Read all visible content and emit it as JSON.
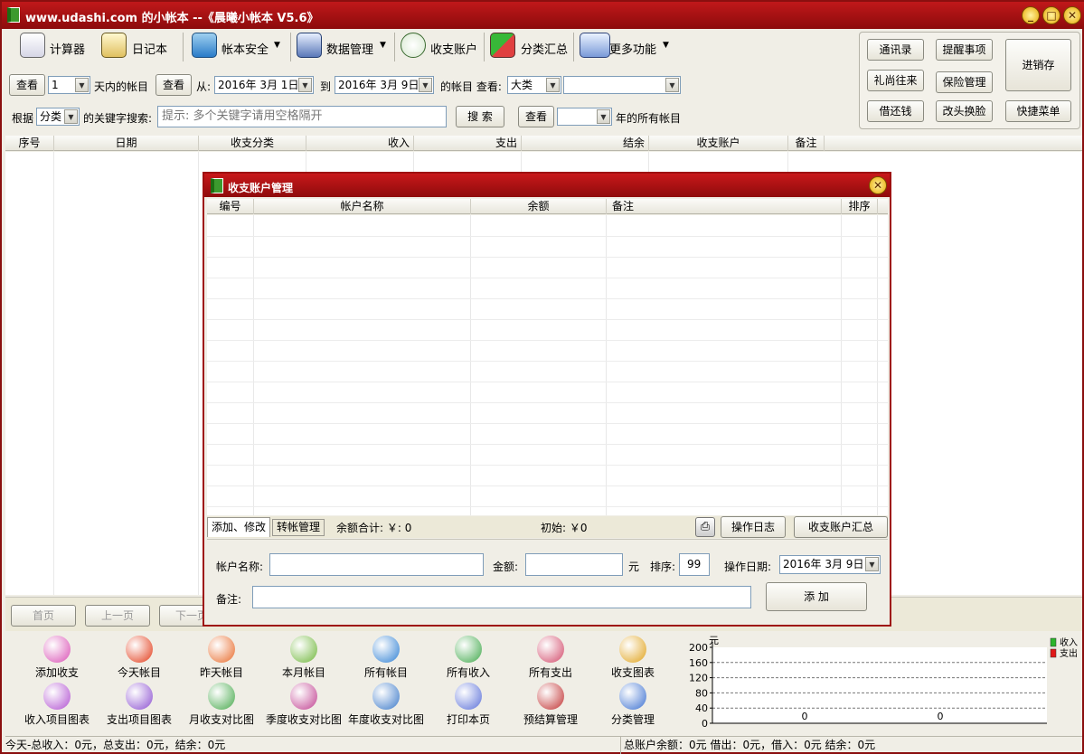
{
  "app": {
    "title": "www.udashi.com 的小帐本 --《晨曦小帐本 V5.6》"
  },
  "toolbar": {
    "items": [
      {
        "label": "计算器",
        "icon": "calculator-icon"
      },
      {
        "label": "日记本",
        "icon": "notebook-icon"
      },
      {
        "label": "帐本安全",
        "icon": "security-icon"
      },
      {
        "label": "数据管理",
        "icon": "data-icon"
      },
      {
        "label": "收支账户",
        "icon": "account-icon"
      },
      {
        "label": "分类汇总",
        "icon": "summary-icon"
      },
      {
        "label": "更多功能",
        "icon": "more-icon"
      }
    ],
    "dropdown_glyph": "▼"
  },
  "quick_panel": {
    "buttons": [
      "通讯录",
      "提醒事项",
      "礼尚往来",
      "保险管理",
      "借还钱",
      "改头换脸",
      "快捷菜单"
    ],
    "big_button": "进销存"
  },
  "filter1": {
    "view_label": "查看",
    "days_value": "1",
    "days_suffix": "天内的帐目",
    "view_label2": "查看",
    "from_label": "从:",
    "from_date": "2016年 3月 1日",
    "to_label": "到",
    "to_date": "2016年 3月 9日",
    "suffix": "的帐目 查看:",
    "type_value": "大类",
    "sub_value": ""
  },
  "filter2": {
    "by_label": "根据",
    "field_value": "分类",
    "keyword_label": "的关键字搜索:",
    "search_placeholder": "提示: 多个关键字请用空格隔开",
    "search_button": "搜 索",
    "view_label": "查看",
    "year_value": "",
    "year_suffix": "年的所有帐目"
  },
  "ledger": {
    "columns": [
      "序号",
      "日期",
      "收支分类",
      "收入",
      "支出",
      "结余",
      "收支账户",
      "备注"
    ]
  },
  "pager": {
    "first": "首页",
    "prev": "上一页",
    "next": "下一页"
  },
  "bottom_buttons": [
    {
      "label": "添加收支",
      "icon": "add-record-icon",
      "color": "#d94fb4"
    },
    {
      "label": "今天帐目",
      "icon": "today-icon",
      "color": "#e23a18"
    },
    {
      "label": "昨天帐目",
      "icon": "yesterday-icon",
      "color": "#e86a2a"
    },
    {
      "label": "本月帐目",
      "icon": "month-icon",
      "color": "#6fb63a"
    },
    {
      "label": "所有帐目",
      "icon": "all-records-icon",
      "color": "#2e7fd3"
    },
    {
      "label": "所有收入",
      "icon": "all-income-icon",
      "color": "#3fa84a"
    },
    {
      "label": "所有支出",
      "icon": "all-expense-icon",
      "color": "#d24a6a"
    },
    {
      "label": "收支图表",
      "icon": "chart-icon",
      "color": "#e0a21a"
    },
    {
      "label": "收入项目图表",
      "icon": "income-chart-icon",
      "color": "#b04fd0"
    },
    {
      "label": "支出项目图表",
      "icon": "expense-chart-icon",
      "color": "#8b4fd0"
    },
    {
      "label": "月收支对比图",
      "icon": "month-compare-icon",
      "color": "#45a84a"
    },
    {
      "label": "季度收支对比图",
      "icon": "quarter-compare-icon",
      "color": "#c04090"
    },
    {
      "label": "年度收支对比图",
      "icon": "year-compare-icon",
      "color": "#3a78c8"
    },
    {
      "label": "打印本页",
      "icon": "print-icon",
      "color": "#5a6fd8"
    },
    {
      "label": "预结算管理",
      "icon": "budget-icon",
      "color": "#c03030"
    },
    {
      "label": "分类管理",
      "icon": "category-icon",
      "color": "#3a6fd0"
    }
  ],
  "chart_data": {
    "type": "bar",
    "ylabel": "元",
    "yticks": [
      0,
      40,
      80,
      120,
      160,
      200
    ],
    "ylim": [
      0,
      200
    ],
    "series": [
      {
        "name": "收入",
        "values": [
          0
        ],
        "color": "#2bb52b"
      },
      {
        "name": "支出",
        "values": [
          0
        ],
        "color": "#e01818"
      }
    ],
    "data_labels": [
      "0",
      "0"
    ],
    "grid": true,
    "legend": "top-right"
  },
  "status": {
    "left": "今天-总收入：0元，总支出：0元，结余：0元",
    "right": "总账户余额：0元 借出：0元，借入：0元 结余：0元"
  },
  "dialog": {
    "title": "收支账户管理",
    "columns": [
      "编号",
      "帐户名称",
      "余额",
      "备注",
      "排序"
    ],
    "tabs": [
      "添加、修改",
      "转帐管理"
    ],
    "balance_total": "余额合计:  ￥:  0",
    "initial": "初始: ￥0",
    "log_button": "操作日志",
    "summary_button": "收支账户汇总",
    "form": {
      "name_label": "帐户名称:",
      "name_value": "",
      "amount_label": "金额:",
      "amount_value": "",
      "unit": "元",
      "order_label": "排序:",
      "order_value": "99",
      "date_label": "操作日期:",
      "date_value": "2016年 3月 9日",
      "note_label": "备注:",
      "note_value": "",
      "add_button": "添 加"
    }
  }
}
